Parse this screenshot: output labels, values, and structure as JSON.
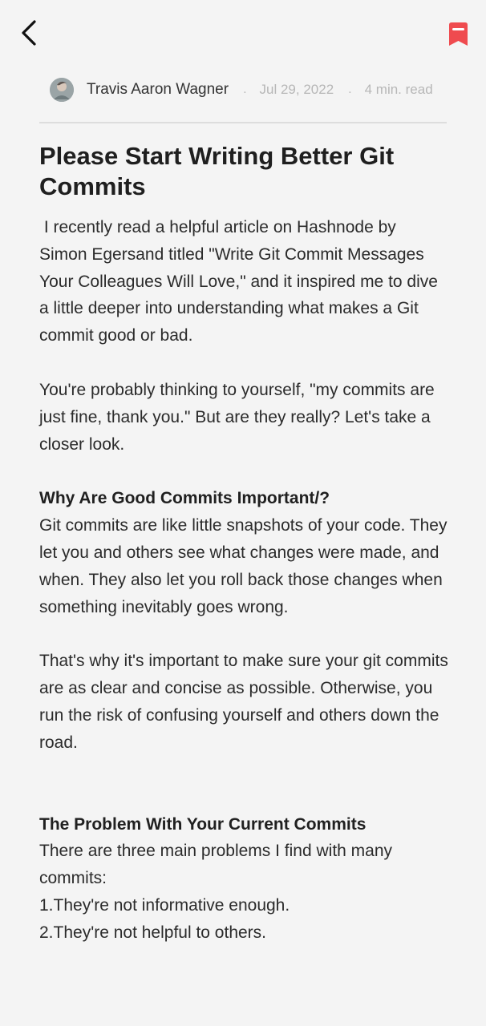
{
  "header": {
    "back_icon": "chevron-left-icon",
    "bookmark_icon": "bookmark-icon",
    "bookmark_color": "#ef4b4f"
  },
  "article_meta": {
    "author": "Travis Aaron Wagner",
    "separator_1": ".",
    "date": "Jul 29, 2022",
    "separator_2": ".",
    "read_time": "4 min. read"
  },
  "article": {
    "title": "Please Start Writing Better Git Commits",
    "paragraph_1": " I recently read a helpful article on Hashnode by Simon Egersand titled \"Write Git Commit Messages Your Colleagues Will Love,\" and it inspired me to dive a little deeper into understanding what makes a Git commit good or bad.",
    "paragraph_2": "You're probably thinking to yourself, \"my commits are just fine, thank you.\" But are they really? Let's take a closer look.",
    "section_1_title": "Why Are Good Commits Important/?",
    "section_1_paragraph_1": "Git commits are like little snapshots of your code. They let you and others see what changes were made, and when. They also let you roll back those changes when something inevitably goes wrong.",
    "section_1_paragraph_2": "That's why it's important to make sure your git commits are as clear and concise as possible. Otherwise, you run the risk of confusing yourself and others down the road.",
    "section_2_title": "The Problem With Your Current Commits",
    "section_2_intro": "There are three main problems I find with many commits:",
    "list_items": [
      "1.They're not informative enough.",
      "2.They're not helpful to others."
    ]
  }
}
